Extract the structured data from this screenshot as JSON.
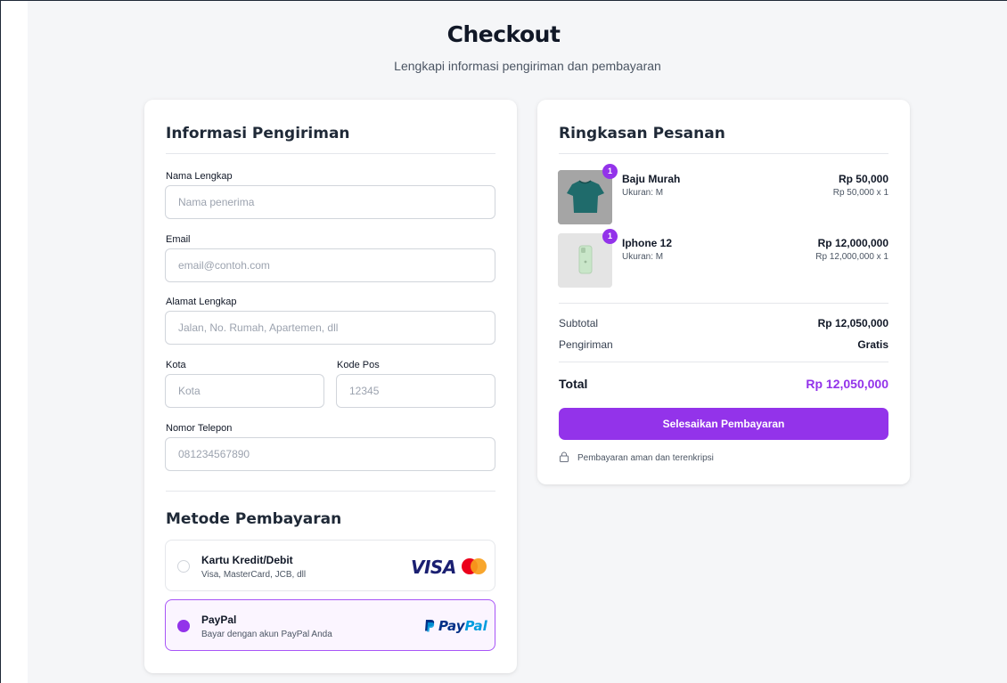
{
  "page": {
    "title": "Checkout",
    "subtitle": "Lengkapi informasi pengiriman dan pembayaran"
  },
  "shipping": {
    "heading": "Informasi Pengiriman",
    "fields": {
      "name": {
        "label": "Nama Lengkap",
        "placeholder": "Nama penerima",
        "value": ""
      },
      "email": {
        "label": "Email",
        "placeholder": "email@contoh.com",
        "value": ""
      },
      "address": {
        "label": "Alamat Lengkap",
        "placeholder": "Jalan, No. Rumah, Apartemen, dll",
        "value": ""
      },
      "city": {
        "label": "Kota",
        "placeholder": "Kota",
        "value": ""
      },
      "postal": {
        "label": "Kode Pos",
        "placeholder": "12345",
        "value": ""
      },
      "phone": {
        "label": "Nomor Telepon",
        "placeholder": "081234567890",
        "value": ""
      }
    }
  },
  "payment": {
    "heading": "Metode Pembayaran",
    "selected": "paypal",
    "options": [
      {
        "id": "card",
        "title": "Kartu Kredit/Debit",
        "description": "Visa, MasterCard, JCB, dll",
        "logo_text": "VISA",
        "icon": "mastercard-icon"
      },
      {
        "id": "paypal",
        "title": "PayPal",
        "description": "Bayar dengan akun PayPal Anda",
        "logo_text_a": "Pay",
        "logo_text_b": "Pal",
        "icon": "paypal-icon"
      }
    ]
  },
  "summary": {
    "heading": "Ringkasan Pesanan",
    "items": [
      {
        "name": "Baju Murah",
        "size": "Ukuran: M",
        "price": "Rp 50,000",
        "qty_line": "Rp 50,000 x 1",
        "badge": "1",
        "image": "teal-tshirt"
      },
      {
        "name": "Iphone 12",
        "size": "Ukuran: M",
        "price": "Rp 12,000,000",
        "qty_line": "Rp 12,000,000 x 1",
        "badge": "1",
        "image": "green-iphone"
      }
    ],
    "subtotal_label": "Subtotal",
    "subtotal_value": "Rp 12,050,000",
    "shipping_label": "Pengiriman",
    "shipping_value": "Gratis",
    "total_label": "Total",
    "total_value": "Rp 12,050,000",
    "pay_button": "Selesaikan Pembayaran",
    "secure_note": "Pembayaran aman dan terenkripsi"
  },
  "colors": {
    "accent": "#9333ea",
    "background": "#f5f6f8",
    "card": "#ffffff"
  }
}
